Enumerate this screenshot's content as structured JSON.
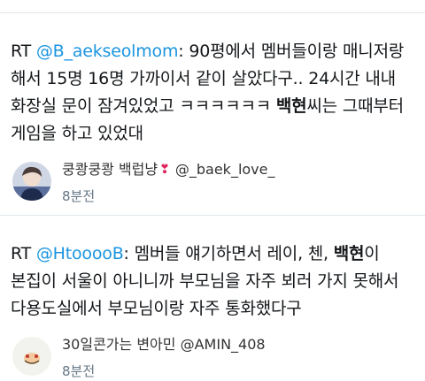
{
  "tweets": [
    {
      "rt": "RT",
      "mention": "@B_aekseolmom",
      "text_before": ": 90평에서 멤버들이랑 매니저랑 해서 15명 16명 가까이서 같이 살았다구.. 24시간 내내 화장실 문이 잠겨있었고 ㅋㅋㅋㅋㅋㅋ ",
      "bold": "백현",
      "text_after": "씨는 그때부터 게임을 하고 있었대",
      "author_name": "쿵쾅쿵쾅 백럽냥",
      "author_heart": "❣",
      "author_handle": "@_baek_love_",
      "time": "8분전",
      "avatar_icon": "avatar-person-photo"
    },
    {
      "rt": "RT",
      "mention": "@HtooooB",
      "text_before": ": 멤버들 얘기하면서 레이, 첸, ",
      "bold": "백현",
      "text_after": "이 본집이 서울이 아니니까 부모님을 자주 뵈러 가지 못해서 다용도실에서 부모님이랑 자주 통화했다구",
      "author_name": "30일콘가는 변아민",
      "author_handle": "@AMIN_408",
      "time": "8분전",
      "avatar_icon": "avatar-illustration"
    }
  ],
  "colors": {
    "mention": "#1b95e0",
    "divider": "#e1e8ed",
    "time": "#657786"
  }
}
